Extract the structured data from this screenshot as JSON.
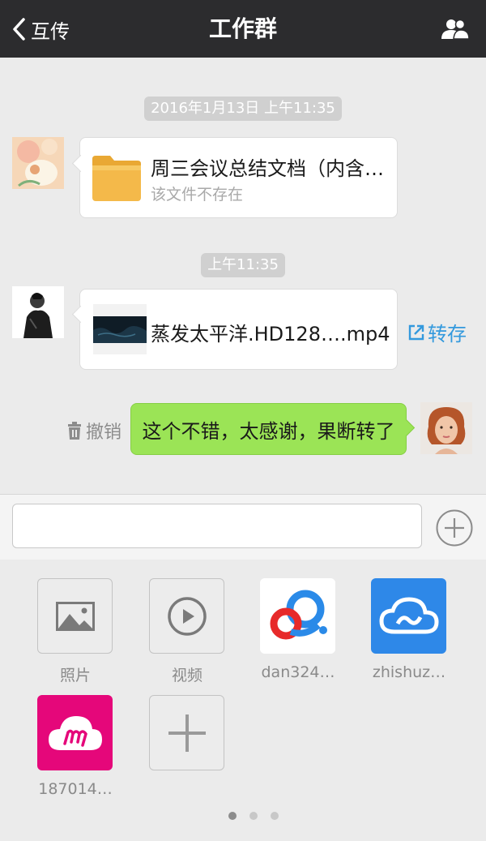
{
  "header": {
    "back_label": "互传",
    "title": "工作群"
  },
  "messages": {
    "timestamp_1": "2016年1月13日 上午11:35",
    "file_message": {
      "name": "周三会议总结文档（内含…",
      "status": "该文件不存在"
    },
    "timestamp_2": "上午11:35",
    "video_message": {
      "name": "蒸发太平洋.HD128….mp4",
      "action": "转存"
    },
    "text_message": {
      "text": "这个不错，太感谢，果断转了",
      "recall": "撤销"
    }
  },
  "panel": {
    "items": [
      {
        "label": "照片",
        "icon": "image-icon"
      },
      {
        "label": "视频",
        "icon": "play-icon"
      },
      {
        "label": "dan324…",
        "icon": "baidu-cloud-icon"
      },
      {
        "label": "zhishuz…",
        "icon": "cloud-icon"
      },
      {
        "label": "187014…",
        "icon": "m-cloud-icon"
      },
      {
        "label": "",
        "icon": "plus-icon"
      }
    ],
    "page_count": 3,
    "active_page": 1
  },
  "colors": {
    "topbar": "#2c2c2e",
    "bubble_green": "#9be456",
    "link_blue": "#3399dd",
    "app_blue": "#2e88e8",
    "app_pink": "#e5077a"
  }
}
